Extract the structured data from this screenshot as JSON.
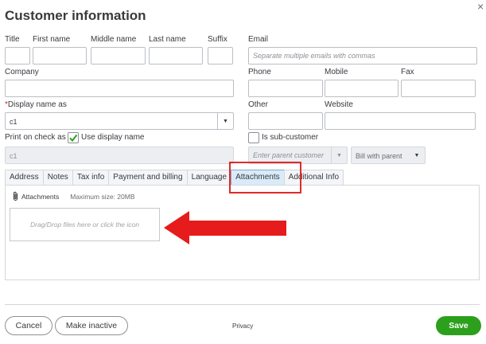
{
  "dialog": {
    "title": "Customer information",
    "close_icon": "×"
  },
  "name_fields": {
    "title_label": "Title",
    "first_label": "First name",
    "middle_label": "Middle name",
    "last_label": "Last name",
    "suffix_label": "Suffix"
  },
  "email": {
    "label": "Email",
    "placeholder": "Separate multiple emails with commas"
  },
  "company": {
    "label": "Company"
  },
  "phone": {
    "label": "Phone"
  },
  "mobile": {
    "label": "Mobile"
  },
  "fax": {
    "label": "Fax"
  },
  "display_name": {
    "required_mark": "*",
    "label": "Display name as",
    "value": "c1"
  },
  "other": {
    "label": "Other"
  },
  "website": {
    "label": "Website"
  },
  "print_on_check": {
    "label": "Print on check as",
    "checkbox_label": "Use display name",
    "checked": true,
    "value": "c1"
  },
  "sub_customer": {
    "checkbox_label": "Is sub-customer",
    "checked": false,
    "parent_placeholder": "Enter parent customer",
    "billing_option": "Bill with parent"
  },
  "tabs": [
    {
      "label": "Address"
    },
    {
      "label": "Notes"
    },
    {
      "label": "Tax info"
    },
    {
      "label": "Payment and billing"
    },
    {
      "label": "Language"
    },
    {
      "label": "Attachments"
    },
    {
      "label": "Additional Info"
    }
  ],
  "active_tab": "Attachments",
  "attachments": {
    "icon": "paperclip-icon",
    "label": "Attachments",
    "max_size": "Maximum size: 20MB",
    "dropzone_text": "Drag/Drop files here or click the icon"
  },
  "footer": {
    "cancel_label": "Cancel",
    "make_inactive_label": "Make inactive",
    "privacy_label": "Privacy",
    "save_label": "Save"
  },
  "colors": {
    "highlight_red": "#e02a2a",
    "save_green": "#2ca01c",
    "active_tab_bg": "#d9ebf9"
  }
}
